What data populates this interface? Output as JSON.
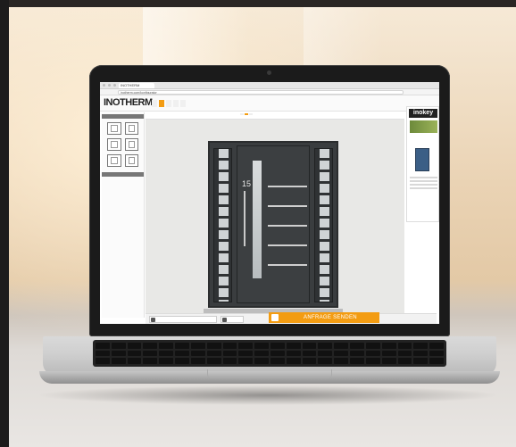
{
  "browser": {
    "tab_title": "INOTHERM",
    "url": "inotherm.com/konfigurator"
  },
  "app": {
    "logo": "INOTHERM",
    "nav": [
      "",
      "",
      "",
      "",
      ""
    ]
  },
  "sidebar": {
    "sections": [
      "",
      ""
    ]
  },
  "toolbar": {
    "label": "",
    "toggles": [
      "",
      "",
      ""
    ]
  },
  "door": {
    "house_number": "15"
  },
  "bottom": {
    "btn1": "",
    "btn2": ""
  },
  "cta": {
    "label": "ANFRAGE SENDEN"
  },
  "ad": {
    "logo": "inokey"
  },
  "colors": {
    "accent": "#f39c12",
    "door": "#3c3f41"
  }
}
